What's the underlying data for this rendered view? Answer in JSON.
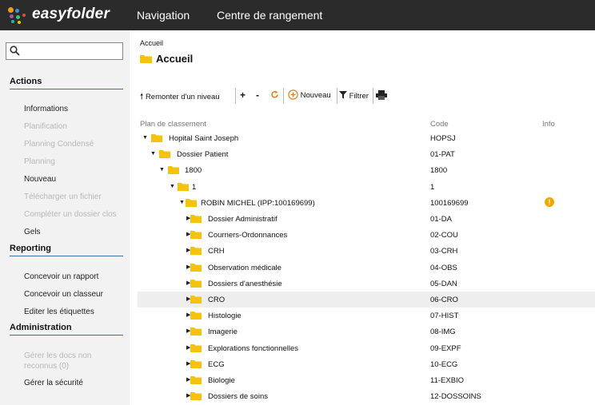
{
  "header": {
    "brand": "easyfolder",
    "nav": [
      "Navigation",
      "Centre de rangement"
    ]
  },
  "sidebar": {
    "search_placeholder": "",
    "sections": [
      {
        "title": "Actions",
        "items": [
          {
            "label": "Informations",
            "enabled": true
          },
          {
            "label": "Planification",
            "enabled": false
          },
          {
            "label": "Planning Condensé",
            "enabled": false
          },
          {
            "label": "Planning",
            "enabled": false
          },
          {
            "label": "Nouveau",
            "enabled": true
          },
          {
            "label": "Télécharger un fichier",
            "enabled": false
          },
          {
            "label": "Compléter un dossier clos",
            "enabled": false
          },
          {
            "label": "Gels",
            "enabled": true
          }
        ]
      },
      {
        "title": "Reporting",
        "items": [
          {
            "label": "Concevoir un rapport",
            "enabled": true
          },
          {
            "label": "Concevoir un classeur",
            "enabled": true
          },
          {
            "label": "Editer les étiquettes",
            "enabled": true
          }
        ]
      },
      {
        "title": "Administration",
        "items": [
          {
            "label": "Gérer les docs non reconnus (0)",
            "enabled": false
          },
          {
            "label": "Gérer la sécurité",
            "enabled": true
          }
        ]
      }
    ]
  },
  "breadcrumb": "Accueil",
  "page_title": "Accueil",
  "toolbar": {
    "up_label": "Remonter d'un niveau",
    "plus": "+",
    "minus": "-",
    "new_label": "Nouveau",
    "filter_label": "Filtrer"
  },
  "table": {
    "headers": {
      "plan": "Plan de classement",
      "code": "Code",
      "info": "Info"
    },
    "rows": [
      {
        "label": "Hopital Saint Joseph",
        "code": "HOPSJ",
        "level": 0,
        "expanded": true
      },
      {
        "label": "Dossier Patient",
        "code": "01-PAT",
        "level": 1,
        "expanded": true
      },
      {
        "label": "1800",
        "code": "1800",
        "level": 2,
        "expanded": true
      },
      {
        "label": "1",
        "code": "1",
        "level": 3,
        "expanded": true
      },
      {
        "label": "ROBIN MICHEL (IPP:100169699)",
        "code": "100169699",
        "level": 4,
        "expanded": true,
        "info": "!"
      },
      {
        "label": "Dossier Administratif",
        "code": "01-DA",
        "level": 5,
        "expanded": false
      },
      {
        "label": "Courriers-Ordonnances",
        "code": "02-COU",
        "level": 5,
        "expanded": false
      },
      {
        "label": "CRH",
        "code": "03-CRH",
        "level": 5,
        "expanded": false
      },
      {
        "label": "Observation médicale",
        "code": "04-OBS",
        "level": 5,
        "expanded": false
      },
      {
        "label": "Dossiers d'anesthésie",
        "code": "05-DAN",
        "level": 5,
        "expanded": false
      },
      {
        "label": "CRO",
        "code": "06-CRO",
        "level": 5,
        "expanded": false,
        "selected": true
      },
      {
        "label": "Histologie",
        "code": "07-HIST",
        "level": 5,
        "expanded": false
      },
      {
        "label": "Imagerie",
        "code": "08-IMG",
        "level": 5,
        "expanded": false
      },
      {
        "label": "Explorations fonctionnelles",
        "code": "09-EXPF",
        "level": 5,
        "expanded": false
      },
      {
        "label": "ECG",
        "code": "10-ECG",
        "level": 5,
        "expanded": false
      },
      {
        "label": "Biologie",
        "code": "11-EXBIO",
        "level": 5,
        "expanded": false
      },
      {
        "label": "Dossiers de soins",
        "code": "12-DOSSOINS",
        "level": 5,
        "expanded": false
      }
    ]
  },
  "colors": {
    "folder": "#f5c20f",
    "info": "#f0a800",
    "accent": "#3d6fa7",
    "topbar": "#2b2b2b"
  }
}
